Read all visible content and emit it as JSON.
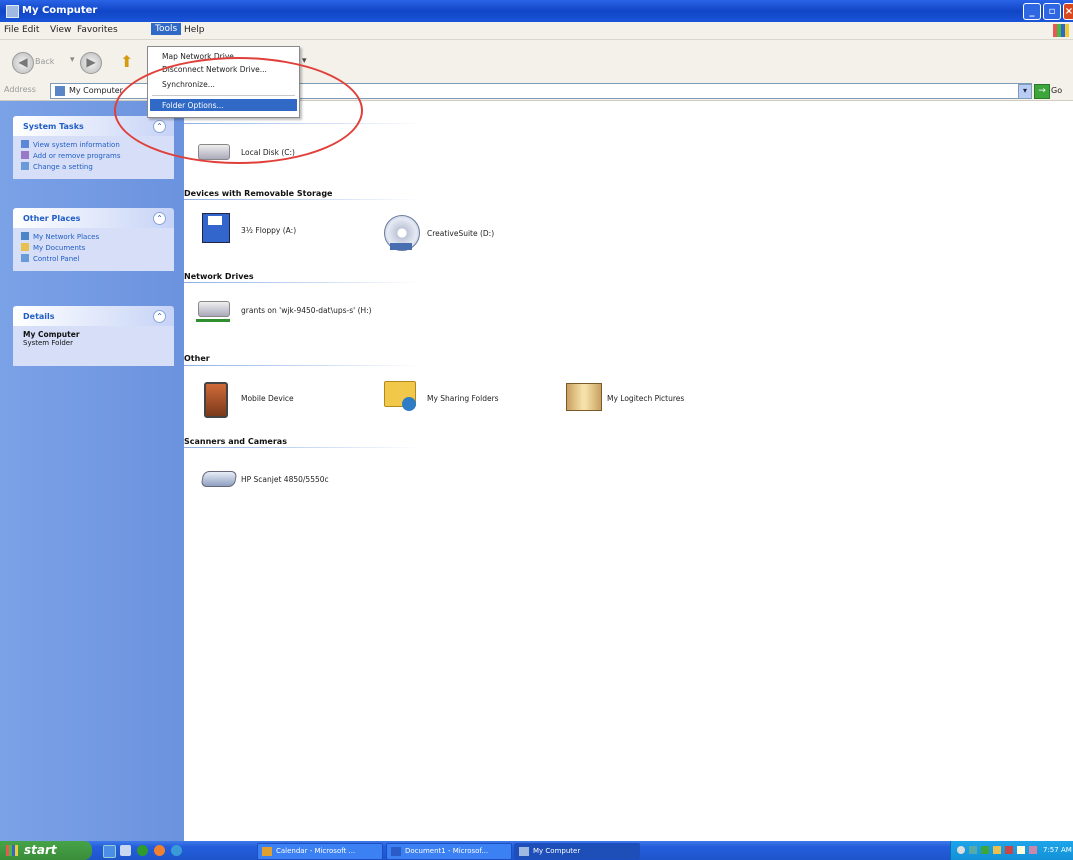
{
  "window": {
    "title": "My Computer"
  },
  "menubar": {
    "items": [
      "File",
      "Edit",
      "View",
      "Favorites",
      "Tools",
      "Help"
    ]
  },
  "toolbar": {
    "back_label": "Back",
    "up_label": "Up"
  },
  "address": {
    "label": "Address",
    "value": "My Computer",
    "go_label": "Go"
  },
  "tools_menu": {
    "items": [
      "Map Network Drive...",
      "Disconnect Network Drive...",
      "Synchronize...",
      "Folder Options..."
    ],
    "highlighted": "Folder Options..."
  },
  "annotation": {
    "color": "#e0403a"
  },
  "left_panel": {
    "system_tasks": {
      "title": "System Tasks",
      "items": [
        "View system information",
        "Add or remove programs",
        "Change a setting"
      ]
    },
    "other_places": {
      "title": "Other Places",
      "items": [
        "My Network Places",
        "My Documents",
        "Control Panel"
      ]
    },
    "details": {
      "title": "Details",
      "name": "My Computer",
      "type": "System Folder"
    }
  },
  "main": {
    "groups": [
      {
        "title": "",
        "items": [
          {
            "label": "Local Disk (C:)",
            "icon": "hard-drive-icon"
          }
        ]
      },
      {
        "title": "Devices with Removable Storage",
        "items": [
          {
            "label": "3½ Floppy (A:)",
            "icon": "floppy-icon"
          },
          {
            "label": "CreativeSuite (D:)",
            "icon": "cd-drive-icon"
          }
        ]
      },
      {
        "title": "Network Drives",
        "items": [
          {
            "label": "grants on 'wjk-9450-dat\\ups-s' (H:)",
            "icon": "network-drive-icon"
          }
        ]
      },
      {
        "title": "Other",
        "items": [
          {
            "label": "Mobile Device",
            "icon": "mobile-device-icon"
          },
          {
            "label": "My Sharing Folders",
            "icon": "sharing-folder-icon"
          },
          {
            "label": "My Logitech Pictures",
            "icon": "pictures-icon"
          }
        ]
      },
      {
        "title": "Scanners and Cameras",
        "items": [
          {
            "label": "HP Scanjet 4850/5550c",
            "icon": "scanner-icon"
          }
        ]
      }
    ]
  },
  "taskbar": {
    "start_label": "start",
    "tasks": [
      "Calendar - Microsoft ...",
      "Document1 - Microsof...",
      "My Computer"
    ],
    "clock": "7:57 AM"
  }
}
